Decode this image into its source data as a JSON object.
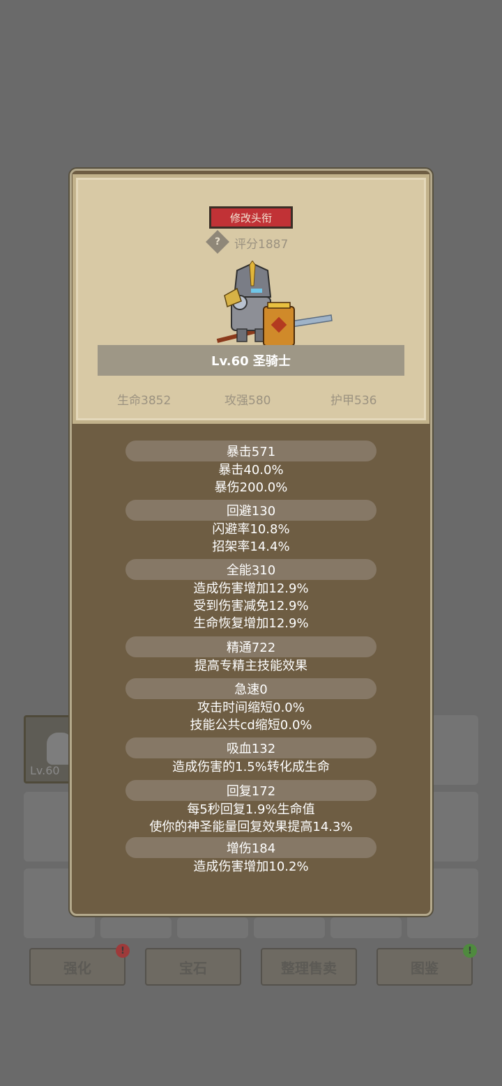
{
  "background": {
    "item": {
      "level": "Lv.60"
    },
    "buttons": [
      {
        "label": "强化",
        "badge": "!",
        "badge_color": "#9e3a3a"
      },
      {
        "label": "宝石"
      },
      {
        "label": "整理售卖"
      },
      {
        "label": "图鉴",
        "badge": "!",
        "badge_color": "#4f8a3e"
      }
    ]
  },
  "header": {
    "rename_label": "修改头衔",
    "help_glyph": "?",
    "score": "评分1887",
    "name": "Lv.60 圣骑士",
    "base_stats": {
      "hp": "生命3852",
      "atk": "攻强580",
      "armor": "护甲536"
    }
  },
  "stats": {
    "crit": {
      "title": "暴击571",
      "lines": [
        "暴击40.0%",
        "暴伤200.0%"
      ]
    },
    "dodge": {
      "title": "回避130",
      "lines": [
        "闪避率10.8%",
        "招架率14.4%"
      ]
    },
    "versatility": {
      "title": "全能310",
      "lines": [
        "造成伤害增加12.9%",
        "受到伤害减免12.9%",
        "生命恢复增加12.9%"
      ]
    },
    "mastery": {
      "title": "精通722",
      "lines": [
        "提高专精主技能效果"
      ]
    },
    "haste": {
      "title": "急速0",
      "lines": [
        "攻击时间缩短0.0%",
        "技能公共cd缩短0.0%"
      ]
    },
    "leech": {
      "title": "吸血132",
      "lines": [
        "造成伤害的1.5%转化成生命"
      ]
    },
    "regen": {
      "title": "回复172",
      "lines": [
        "每5秒回复1.9%生命值",
        "使你的神圣能量回复效果提高14.3%"
      ]
    },
    "damage": {
      "title": "增伤184",
      "lines": [
        "造成伤害增加10.2%"
      ]
    }
  },
  "colors": {
    "panel": "#6e5d43",
    "parchment": "#d8c9a5",
    "rename_button": "#c13236",
    "name_bar": "#9e9786",
    "group_bar": "#867866"
  }
}
